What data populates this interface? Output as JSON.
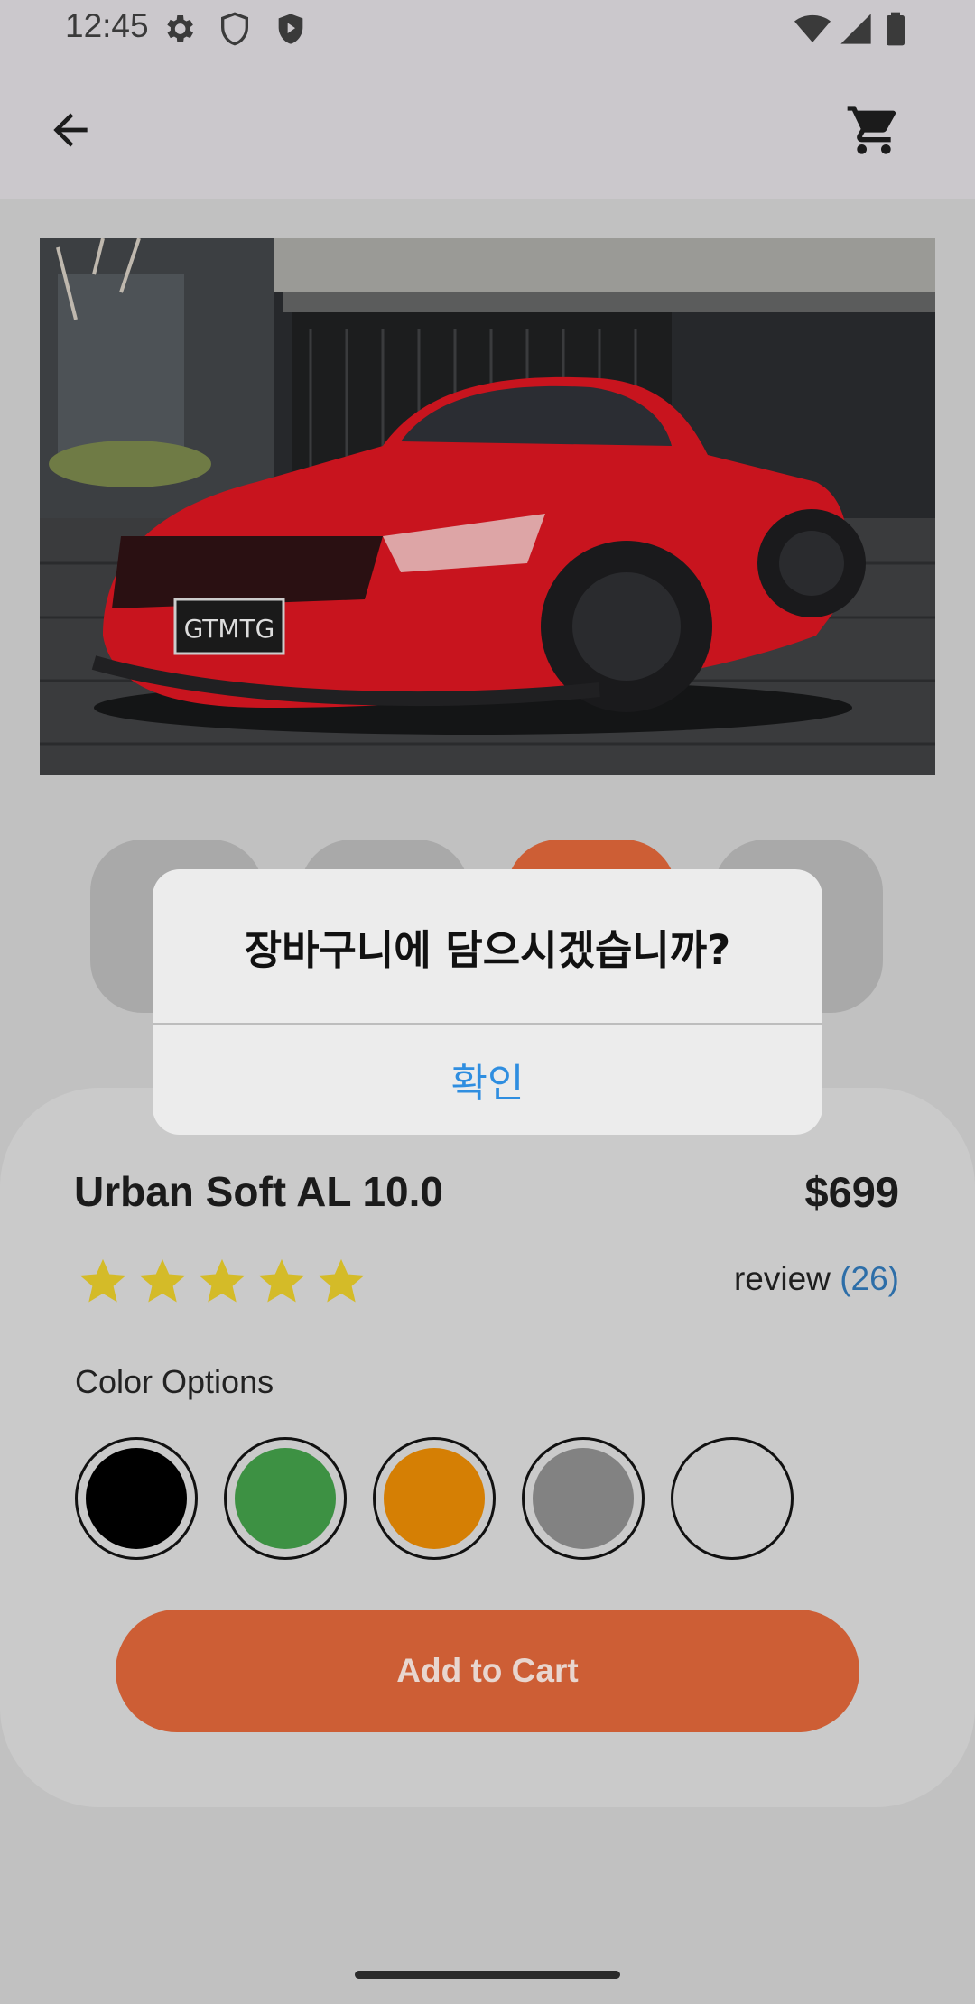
{
  "status_bar": {
    "time": "12:45",
    "icons": [
      "settings-icon",
      "shield-outline-icon",
      "shield-filled-icon",
      "wifi-icon",
      "signal-icon",
      "battery-icon"
    ]
  },
  "app_bar": {
    "icons": [
      "back-arrow-icon",
      "shopping-cart-icon"
    ]
  },
  "hero": {
    "plate_text": "GTMTG"
  },
  "product": {
    "name": "Urban Soft AL 10.0",
    "price": "$699",
    "rating": 5,
    "review_label": "review",
    "review_count": "(26)",
    "color_options_label": "Color Options",
    "colors": [
      "#000000",
      "#3d9143",
      "#d57f04",
      "#828282",
      "#cacaca"
    ],
    "add_to_cart_label": "Add to Cart"
  },
  "dialog": {
    "title": "장바구니에 담으시겠습니까?",
    "confirm_label": "확인"
  },
  "colors": {
    "accent": "#cd5e35",
    "star": "#d4bb28",
    "link": "#2f8ee0"
  }
}
